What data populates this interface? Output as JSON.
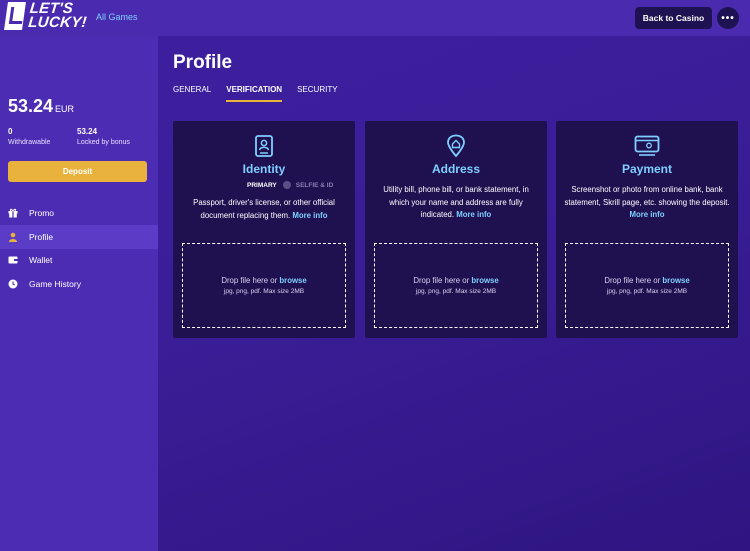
{
  "header": {
    "logo_text_line1": "LET'S",
    "logo_text_line2": "LUCKY!",
    "all_games": "All Games",
    "back_to_casino": "Back to Casino",
    "more": "•••"
  },
  "sidebar": {
    "balance": "53.24",
    "currency": "EUR",
    "withdrawable_value": "0",
    "withdrawable_label": "Withdrawable",
    "locked_value": "53.24",
    "locked_label": "Locked by bonus",
    "deposit_label": "Deposit",
    "items": [
      {
        "label": "Promo",
        "icon": "gift-icon"
      },
      {
        "label": "Profile",
        "icon": "user-icon",
        "active": true
      },
      {
        "label": "Wallet",
        "icon": "wallet-icon"
      },
      {
        "label": "Game History",
        "icon": "clock-icon"
      }
    ]
  },
  "main": {
    "title": "Profile",
    "tabs": [
      {
        "label": "GENERAL"
      },
      {
        "label": "VERIFICATION",
        "active": true
      },
      {
        "label": "SECURITY"
      }
    ],
    "cards": [
      {
        "title": "Identity",
        "icon": "id-card-icon",
        "sub_primary": "PRIMARY",
        "sub_secondary": "SELFIE & ID",
        "desc": "Passport, driver's license, or other official document replacing them.",
        "more_info": "More info",
        "drop_text": "Drop file here or",
        "browse": "browse",
        "formats": "jpg, png, pdf. Max size 2MB"
      },
      {
        "title": "Address",
        "icon": "location-icon",
        "desc": "Utility bill, phone bill, or bank statement, in which your name and address are fully indicated.",
        "more_info": "More info",
        "drop_text": "Drop file here or",
        "browse": "browse",
        "formats": "jpg, png, pdf. Max size 2MB"
      },
      {
        "title": "Payment",
        "icon": "payment-card-icon",
        "desc": "Screenshot or photo from online bank, bank statement, Skrill page, etc. showing the deposit.",
        "more_info": "More info",
        "drop_text": "Drop file here or",
        "browse": "browse",
        "formats": "jpg, png, pdf. Max size 2MB"
      }
    ]
  },
  "colors": {
    "accent": "#7fd0ff",
    "deposit": "#e8b23c",
    "card_bg": "#1f1050",
    "sidebar_bg": "#4d2cb4"
  }
}
